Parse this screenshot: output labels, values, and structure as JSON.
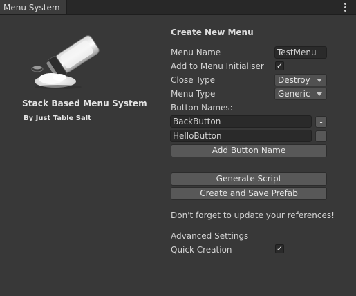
{
  "window": {
    "tab_title": "Menu System"
  },
  "logo": {
    "title": "Stack Based Menu System",
    "subtitle": "By Just Table Salt",
    "icon": "salt-shaker-spill-image"
  },
  "form": {
    "heading": "Create New Menu",
    "menu_name_label": "Menu Name",
    "menu_name_value": "TestMenu",
    "add_to_initialiser_label": "Add to Menu Initialiser",
    "add_to_initialiser_checked": true,
    "close_type_label": "Close Type",
    "close_type_value": "Destroy",
    "menu_type_label": "Menu Type",
    "menu_type_value": "Generic",
    "button_names_label": "Button Names:",
    "button_names": [
      "BackButton",
      "HelloButton"
    ],
    "remove_label": "-",
    "add_button_label": "Add Button Name",
    "generate_script_label": "Generate Script",
    "create_prefab_label": "Create and Save Prefab",
    "reminder": "Don't forget to update your references!",
    "advanced_heading": "Advanced Settings",
    "quick_creation_label": "Quick Creation",
    "quick_creation_checked": true
  },
  "icons": {
    "check": "✓",
    "menu": "kebab-menu-icon"
  }
}
